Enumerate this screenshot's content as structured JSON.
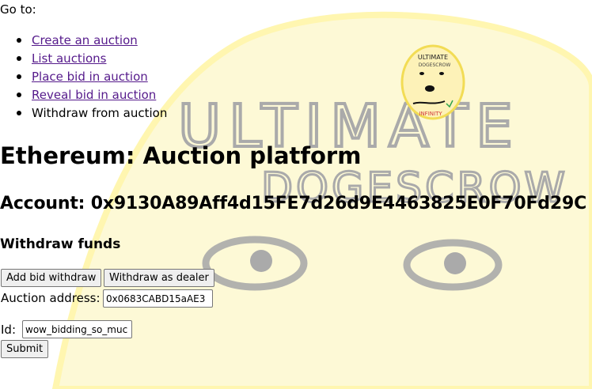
{
  "goto_label": "Go to:",
  "nav": [
    {
      "label": "Create an auction",
      "link": true
    },
    {
      "label": "List auctions",
      "link": true
    },
    {
      "label": "Place bid in auction",
      "link": true
    },
    {
      "label": "Reveal bid in auction",
      "link": true
    },
    {
      "label": "Withdraw from auction",
      "link": false
    }
  ],
  "logo": {
    "top_text": "ULTIMATE",
    "mid_text": "DOGESCROW",
    "bottom_text": "INFINITY"
  },
  "background_text": {
    "line1": "ULTIMATE",
    "line2": "DOGESCROW"
  },
  "title": "Ethereum: Auction platform",
  "account_label": "Account: 0x9130A89Aff4d15FE7d26d9E4463825E0F70Fd29C",
  "section_title": "Withdraw funds",
  "buttons": {
    "add_bid_withdraw": "Add bid withdraw",
    "withdraw_dealer": "Withdraw as dealer",
    "submit": "Submit"
  },
  "form": {
    "auction_address_label": "Auction address:",
    "auction_address_value": "0x0683CABD15aAE3",
    "id_label": "Id:",
    "id_value": "wow_bidding_so_muc"
  },
  "colors": {
    "link": "#551a8b",
    "bg_blob": "#fdf9d6",
    "bg_ring": "#fff6b0",
    "doodle": "#aaaaaa"
  }
}
